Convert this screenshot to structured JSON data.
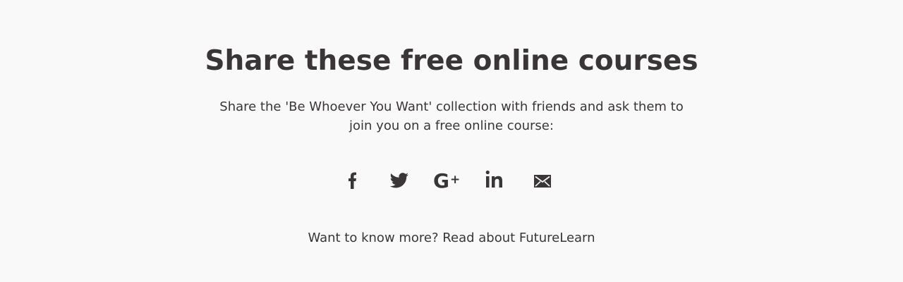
{
  "share": {
    "title": "Share these free online courses",
    "description_line1": "Share the 'Be Whoever You Want' collection with friends and ask them to",
    "description_line2": "join you on a free online course:",
    "icons": [
      "facebook-icon",
      "twitter-icon",
      "google-plus-icon",
      "linkedin-icon",
      "email-icon"
    ]
  },
  "footer": {
    "prompt": "Want to know more?",
    "link_text": "Read about FutureLearn"
  },
  "colors": {
    "background": "#f9f9f9",
    "text": "#3a3536"
  }
}
